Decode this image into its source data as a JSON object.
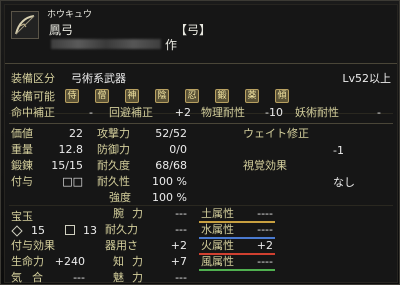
{
  "item": {
    "furigana": "ホウキュウ",
    "name": "鳳弓",
    "category_tag": "【弓】",
    "maker_suffix": "作"
  },
  "header": {
    "equip_class_label": "装備区分",
    "equip_class_value": "弓術系武器",
    "level_req": "Lv52以上",
    "equip_ok_label": "装備可能",
    "classes": [
      {
        "label": "侍",
        "enabled": true
      },
      {
        "label": "僧",
        "enabled": true
      },
      {
        "label": "神",
        "enabled": true
      },
      {
        "label": "陰",
        "enabled": true
      },
      {
        "label": "忍",
        "enabled": true
      },
      {
        "label": "鍛",
        "enabled": true
      },
      {
        "label": "薬",
        "enabled": true
      },
      {
        "label": "傾",
        "enabled": true
      }
    ]
  },
  "bonus_row": {
    "items": [
      {
        "label": "命中補正",
        "value": "-"
      },
      {
        "label": "回避補正",
        "value": "+2"
      },
      {
        "label": "物理耐性",
        "value": "-10"
      },
      {
        "label": "妖術耐性",
        "value": "-"
      }
    ]
  },
  "stats_left": [
    {
      "label": "価値",
      "value": "22"
    },
    {
      "label": "重量",
      "value": "12.8"
    },
    {
      "label": "鍛錬",
      "value": "15/15"
    },
    {
      "label": "付与",
      "value": "□□"
    }
  ],
  "stats_mid": [
    {
      "label": "攻撃力",
      "value": "52/52"
    },
    {
      "label": "防御力",
      "value": "0/0"
    },
    {
      "label": "耐久度",
      "value": "68/68"
    },
    {
      "label": "耐久性",
      "value": "100 %"
    },
    {
      "label": "強度",
      "value": "100 %"
    }
  ],
  "stats_right": {
    "weight_label": "ウェイト修正",
    "weight_value": "-1",
    "visual_label": "視覚効果",
    "visual_value": "なし"
  },
  "gems": {
    "label": "宝玉",
    "diamond_count": "15",
    "square_count": "13"
  },
  "enchant_label": "付与効果",
  "left_bonus": [
    {
      "label": "生命力",
      "value": "+240"
    },
    {
      "label": "気合",
      "value": "---"
    }
  ],
  "mid_bonus": [
    {
      "label": "腕力",
      "value": "---"
    },
    {
      "label": "耐久力",
      "value": "---"
    },
    {
      "label": "器用さ",
      "value": "+2"
    },
    {
      "label": "知力",
      "value": "+7"
    },
    {
      "label": "魅力",
      "value": "---"
    }
  ],
  "elements": [
    {
      "label": "土属性",
      "value": "----",
      "color": "#c8a040"
    },
    {
      "label": "水属性",
      "value": "----",
      "color": "#4a7ad0"
    },
    {
      "label": "火属性",
      "value": "+2",
      "color": "#d04030"
    },
    {
      "label": "風属性",
      "value": "----",
      "color": "#50b050"
    }
  ]
}
